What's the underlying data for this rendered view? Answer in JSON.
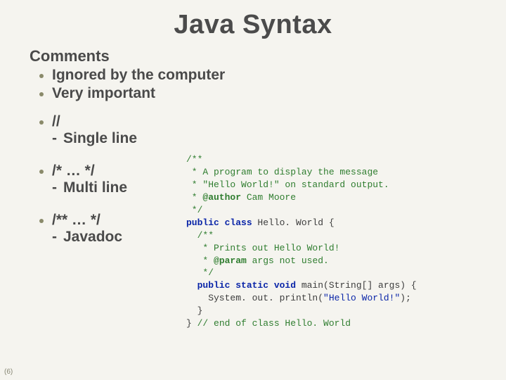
{
  "title": "Java Syntax",
  "heading": "Comments",
  "bullets": [
    "Ignored by the computer",
    "Very important"
  ],
  "syntax": [
    {
      "head": "//",
      "sub": "Single line"
    },
    {
      "head": "/* … */",
      "sub": "Multi line"
    },
    {
      "head": "/** … */",
      "sub": "Javadoc"
    }
  ],
  "code": {
    "l1": "/**",
    "l2": " * A program to display the message",
    "l3": " * \"Hello World!\" on standard output.",
    "l4a": " * ",
    "l4b": "@author",
    "l4c": " Cam Moore",
    "l5": " */",
    "l6a": "public class ",
    "l6b": "Hello. World",
    "l6c": " {",
    "l7": "  /**",
    "l8": "   * Prints out Hello World!",
    "l9a": "   * ",
    "l9b": "@param",
    "l9c": " args not used.",
    "l10": "   */",
    "l11a": "  public static void ",
    "l11b": "main",
    "l11c": "(String[] args) {",
    "l12a": "    System. out. println(",
    "l12b": "\"Hello World!\"",
    "l12c": ");",
    "l13": "  }",
    "l14a": "} ",
    "l14b": "// end of class Hello. World"
  },
  "page_number": "(6)"
}
